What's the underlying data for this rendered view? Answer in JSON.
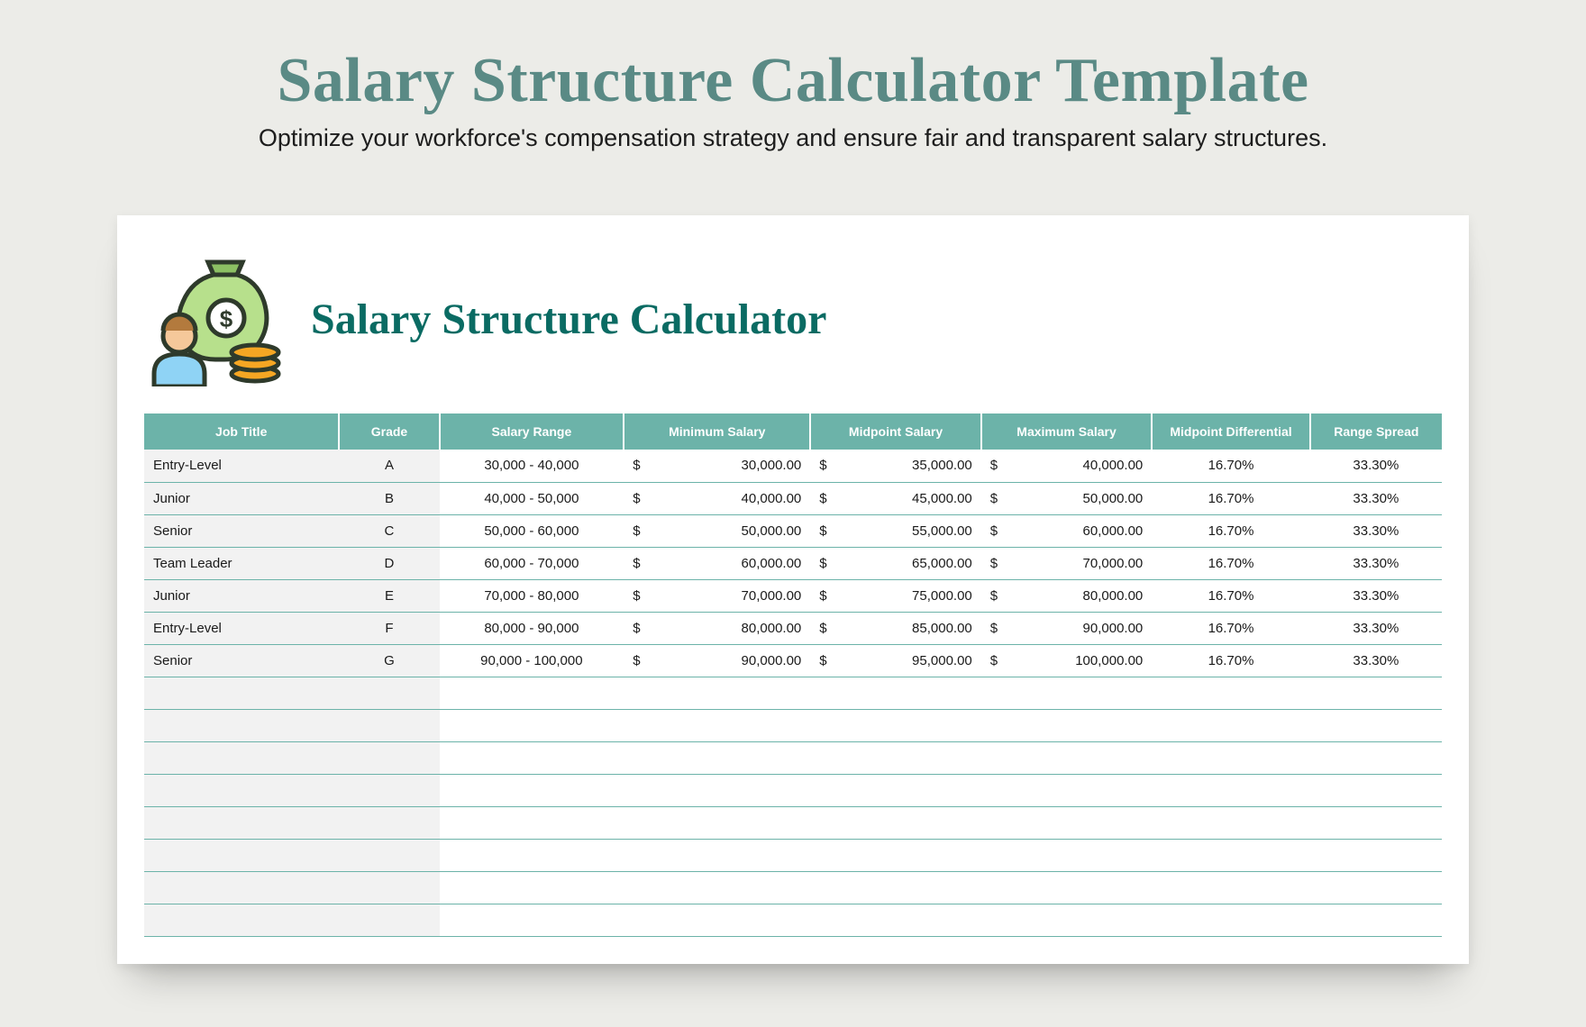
{
  "page": {
    "title": "Salary Structure Calculator Template",
    "subtitle": "Optimize your workforce's compensation strategy and ensure fair and transparent salary structures."
  },
  "card": {
    "title": "Salary Structure Calculator"
  },
  "table": {
    "headers": {
      "job": "Job Title",
      "grade": "Grade",
      "range": "Salary Range",
      "min": "Minimum Salary",
      "mid": "Midpoint Salary",
      "max": "Maximum Salary",
      "diff": "Midpoint Differential",
      "spread": "Range Spread"
    },
    "rows": [
      {
        "job": "Entry-Level",
        "grade": "A",
        "range": "30,000 - 40,000",
        "min": "30,000.00",
        "mid": "35,000.00",
        "max": "40,000.00",
        "diff": "16.70%",
        "spread": "33.30%"
      },
      {
        "job": "Junior",
        "grade": "B",
        "range": "40,000 - 50,000",
        "min": "40,000.00",
        "mid": "45,000.00",
        "max": "50,000.00",
        "diff": "16.70%",
        "spread": "33.30%"
      },
      {
        "job": "Senior",
        "grade": "C",
        "range": "50,000 - 60,000",
        "min": "50,000.00",
        "mid": "55,000.00",
        "max": "60,000.00",
        "diff": "16.70%",
        "spread": "33.30%"
      },
      {
        "job": "Team Leader",
        "grade": "D",
        "range": "60,000 - 70,000",
        "min": "60,000.00",
        "mid": "65,000.00",
        "max": "70,000.00",
        "diff": "16.70%",
        "spread": "33.30%"
      },
      {
        "job": "Junior",
        "grade": "E",
        "range": "70,000 - 80,000",
        "min": "70,000.00",
        "mid": "75,000.00",
        "max": "80,000.00",
        "diff": "16.70%",
        "spread": "33.30%"
      },
      {
        "job": "Entry-Level",
        "grade": "F",
        "range": "80,000 - 90,000",
        "min": "80,000.00",
        "mid": "85,000.00",
        "max": "90,000.00",
        "diff": "16.70%",
        "spread": "33.30%"
      },
      {
        "job": "Senior",
        "grade": "G",
        "range": "90,000 - 100,000",
        "min": "90,000.00",
        "mid": "95,000.00",
        "max": "100,000.00",
        "diff": "16.70%",
        "spread": "33.30%"
      }
    ],
    "emptyRows": 8,
    "currency": "$"
  },
  "colors": {
    "headerBg": "#6cb3a9",
    "titleTeal": "#0a6b63",
    "accentTeal": "#5a8a85"
  }
}
